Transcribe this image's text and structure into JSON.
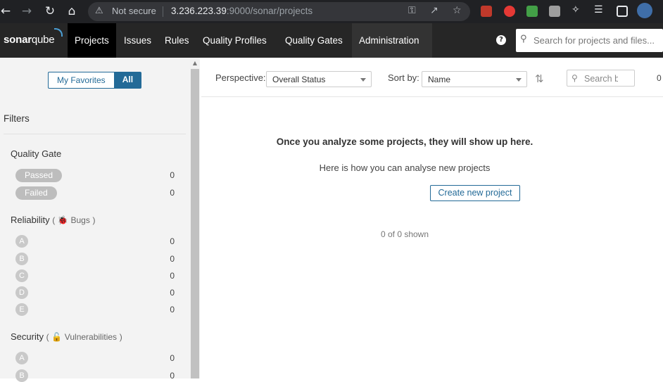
{
  "browser": {
    "warning_text": "Not secure",
    "url_host": "3.236.223.39",
    "url_rest": ":9000/sonar/projects",
    "icons": [
      "back-icon",
      "forward-icon",
      "reload-icon",
      "home-icon",
      "key-icon",
      "share-icon",
      "star-icon"
    ]
  },
  "nav": {
    "logo_bold": "sonar",
    "logo_light": "qube",
    "items": [
      "Projects",
      "Issues",
      "Rules",
      "Quality Profiles",
      "Quality Gates",
      "Administration"
    ],
    "help": "?",
    "search_placeholder": "Search for projects and files..."
  },
  "sidebar": {
    "toggle": {
      "favorites": "My Favorites",
      "all": "All"
    },
    "filters_title": "Filters",
    "quality_gate": {
      "title": "Quality Gate",
      "options": [
        {
          "label": "Passed",
          "count": "0"
        },
        {
          "label": "Failed",
          "count": "0"
        }
      ]
    },
    "reliability": {
      "title": "Reliability",
      "open": "(",
      "sub": "Bugs",
      "close": ")",
      "ratings": [
        {
          "label": "A",
          "count": "0"
        },
        {
          "label": "B",
          "count": "0"
        },
        {
          "label": "C",
          "count": "0"
        },
        {
          "label": "D",
          "count": "0"
        },
        {
          "label": "E",
          "count": "0"
        }
      ]
    },
    "security": {
      "title": "Security",
      "open": "(",
      "sub": "Vulnerabilities",
      "close": ")",
      "ratings": [
        {
          "label": "A",
          "count": "0"
        },
        {
          "label": "B",
          "count": "0"
        }
      ]
    }
  },
  "toolbar": {
    "perspective_label": "Perspective:",
    "perspective_value": "Overall Status",
    "sort_label": "Sort by:",
    "sort_value": "Name",
    "search_placeholder": "Search by",
    "count": "0"
  },
  "main": {
    "empty_title": "Once you analyze some projects, they will show up here.",
    "empty_sub": "Here is how you can analyse new projects",
    "create_button": "Create new project",
    "shown": "0 of 0 shown"
  },
  "colors": {
    "accent": "#236a97",
    "nav_bg": "#262626",
    "chrome_bg": "#202124"
  }
}
